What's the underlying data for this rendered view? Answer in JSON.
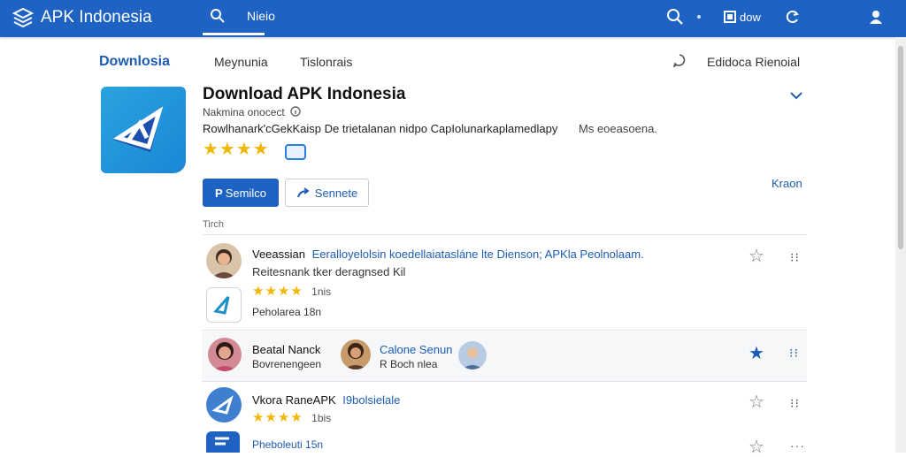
{
  "topbar": {
    "brand": "APK Indonesia",
    "search_query": "Nieio",
    "btn_label": "dow"
  },
  "tabs": [
    {
      "label": "Downlosia",
      "active": true
    },
    {
      "label": "Meynunia"
    },
    {
      "label": "Tislonrais"
    }
  ],
  "header_right_label": "Edidoca Rienoial",
  "app": {
    "title": "Download APK Indonesia",
    "meta": "Nakmina onocect",
    "description": "Rowlhanark'cGekKaisp De trietalanan nidpo CapIolunarkaplamedlapy",
    "description_tail": "Ms eoeasoena.",
    "rating_stars": "★★★★",
    "primary_button": "Semilco",
    "secondary_button": "Sennete",
    "side_link": "Kraon"
  },
  "list_label": "Tirch",
  "items": [
    {
      "title": "Veeassian",
      "title_link": "Eeralloyelolsin koedellaiatasláne lte Dienson; APKla Peolnolaam.",
      "subtitle": "Reitesnank tker deragnsed Kil",
      "stars": "★★★★",
      "count": "1nis",
      "tag": "Peholarea 18n"
    },
    {
      "person1_name": "Beatal Nanck",
      "person1_sub": "Bovrenengeen",
      "person2_name": "Calone Senun",
      "person2_sub": "R Boch nlea"
    },
    {
      "title": "Vkora RaneAPK",
      "title_link": "I9bolsielale",
      "stars": "★★★★",
      "count": "1bis",
      "tag": "Pheboleuti 15n"
    }
  ],
  "colors": {
    "brand_blue": "#1e63c4",
    "link_blue": "#1d5cb3",
    "star_gold": "#f2b705"
  },
  "icons": [
    "apk-logo-icon",
    "search-icon",
    "notification-icon",
    "refresh-icon",
    "user-icon",
    "chat-icon",
    "chevron-down-icon",
    "share-icon",
    "star-icon",
    "more-icon"
  ]
}
